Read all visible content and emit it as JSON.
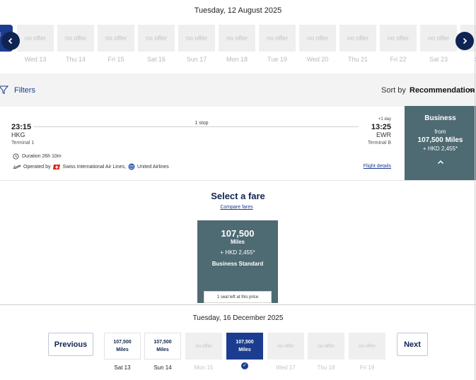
{
  "top": {
    "date": "Tuesday, 12 August 2025",
    "left_tab_text": "ç",
    "no_offer_label": "no offer",
    "days": [
      "Wed 13",
      "Thu 14",
      "Fri 15",
      "Sat 16",
      "Sun 17",
      "Mon 18",
      "Tue 19",
      "Wed 20",
      "Thu 21",
      "Fri 22",
      "Sat 23",
      "Su"
    ]
  },
  "filters": {
    "label": "Filters",
    "sort_by": "Sort by",
    "sort_value": "Recommendation"
  },
  "flight": {
    "departure_time": "23:15",
    "departure_code": "HKG",
    "departure_terminal": "Terminal 1",
    "stops": "1 stop",
    "plus_day": "+1 day",
    "arrival_time": "13:25",
    "arrival_code": "EWR",
    "arrival_terminal": "Terminal B",
    "duration": "Duration 26h 10m",
    "operated_by": "Operated by",
    "airline1": "Swiss International Air Lines,",
    "airline2": "United Airlines",
    "details_link": "Flight details"
  },
  "cabin": {
    "title": "Business",
    "from": "from",
    "miles": "107,500 Miles",
    "hkd": "+ HKD 2,455*"
  },
  "fare": {
    "heading": "Select a fare",
    "compare": "Compare fares",
    "miles": "107,500",
    "miles_label": "Miles",
    "hkd": "+ HKD 2,455*",
    "name": "Business Standard",
    "seats_left": "1 seat left at this price"
  },
  "bottom": {
    "date": "Tuesday, 16 December 2025",
    "previous": "Previous",
    "next": "Next",
    "days": [
      {
        "label": "Sat 13",
        "value": "107,500",
        "unit": "Miles",
        "state": "offer"
      },
      {
        "label": "Sun 14",
        "value": "107,500",
        "unit": "Miles",
        "state": "offer"
      },
      {
        "label": "Mon 15",
        "value": "no offer",
        "unit": "",
        "state": "none"
      },
      {
        "label": "",
        "value": "107,500",
        "unit": "Miles",
        "state": "selected"
      },
      {
        "label": "Wed 17",
        "value": "no offer",
        "unit": "",
        "state": "none"
      },
      {
        "label": "Thu 18",
        "value": "no offer",
        "unit": "",
        "state": "none"
      },
      {
        "label": "Fri 19",
        "value": "no offer",
        "unit": "",
        "state": "none"
      }
    ]
  },
  "colors": {
    "brand_navy": "#0f2452",
    "brand_blue": "#1c3d8f",
    "fare_card": "#4e6a73"
  }
}
